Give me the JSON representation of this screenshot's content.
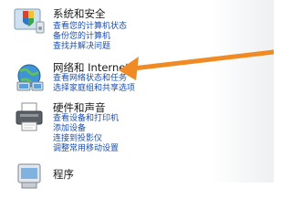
{
  "categories": [
    {
      "title": "系统和安全",
      "icon": "shield-icon",
      "links": [
        "查看您的计算机状态",
        "备份您的计算机",
        "查找并解决问题"
      ]
    },
    {
      "title": "网络和 Internet",
      "icon": "network-globe-icon",
      "links": [
        "查看网络状态和任务",
        "选择家庭组和共享选项"
      ]
    },
    {
      "title": "硬件和声音",
      "icon": "printer-icon",
      "links": [
        "查看设备和打印机",
        "添加设备",
        "连接到投影仪",
        "调整常用移动设置"
      ]
    },
    {
      "title": "程序",
      "icon": "programs-icon",
      "links": []
    }
  ],
  "annotation": {
    "arrow_color": "#f08a24",
    "points_to": "查看网络状态和任务"
  }
}
